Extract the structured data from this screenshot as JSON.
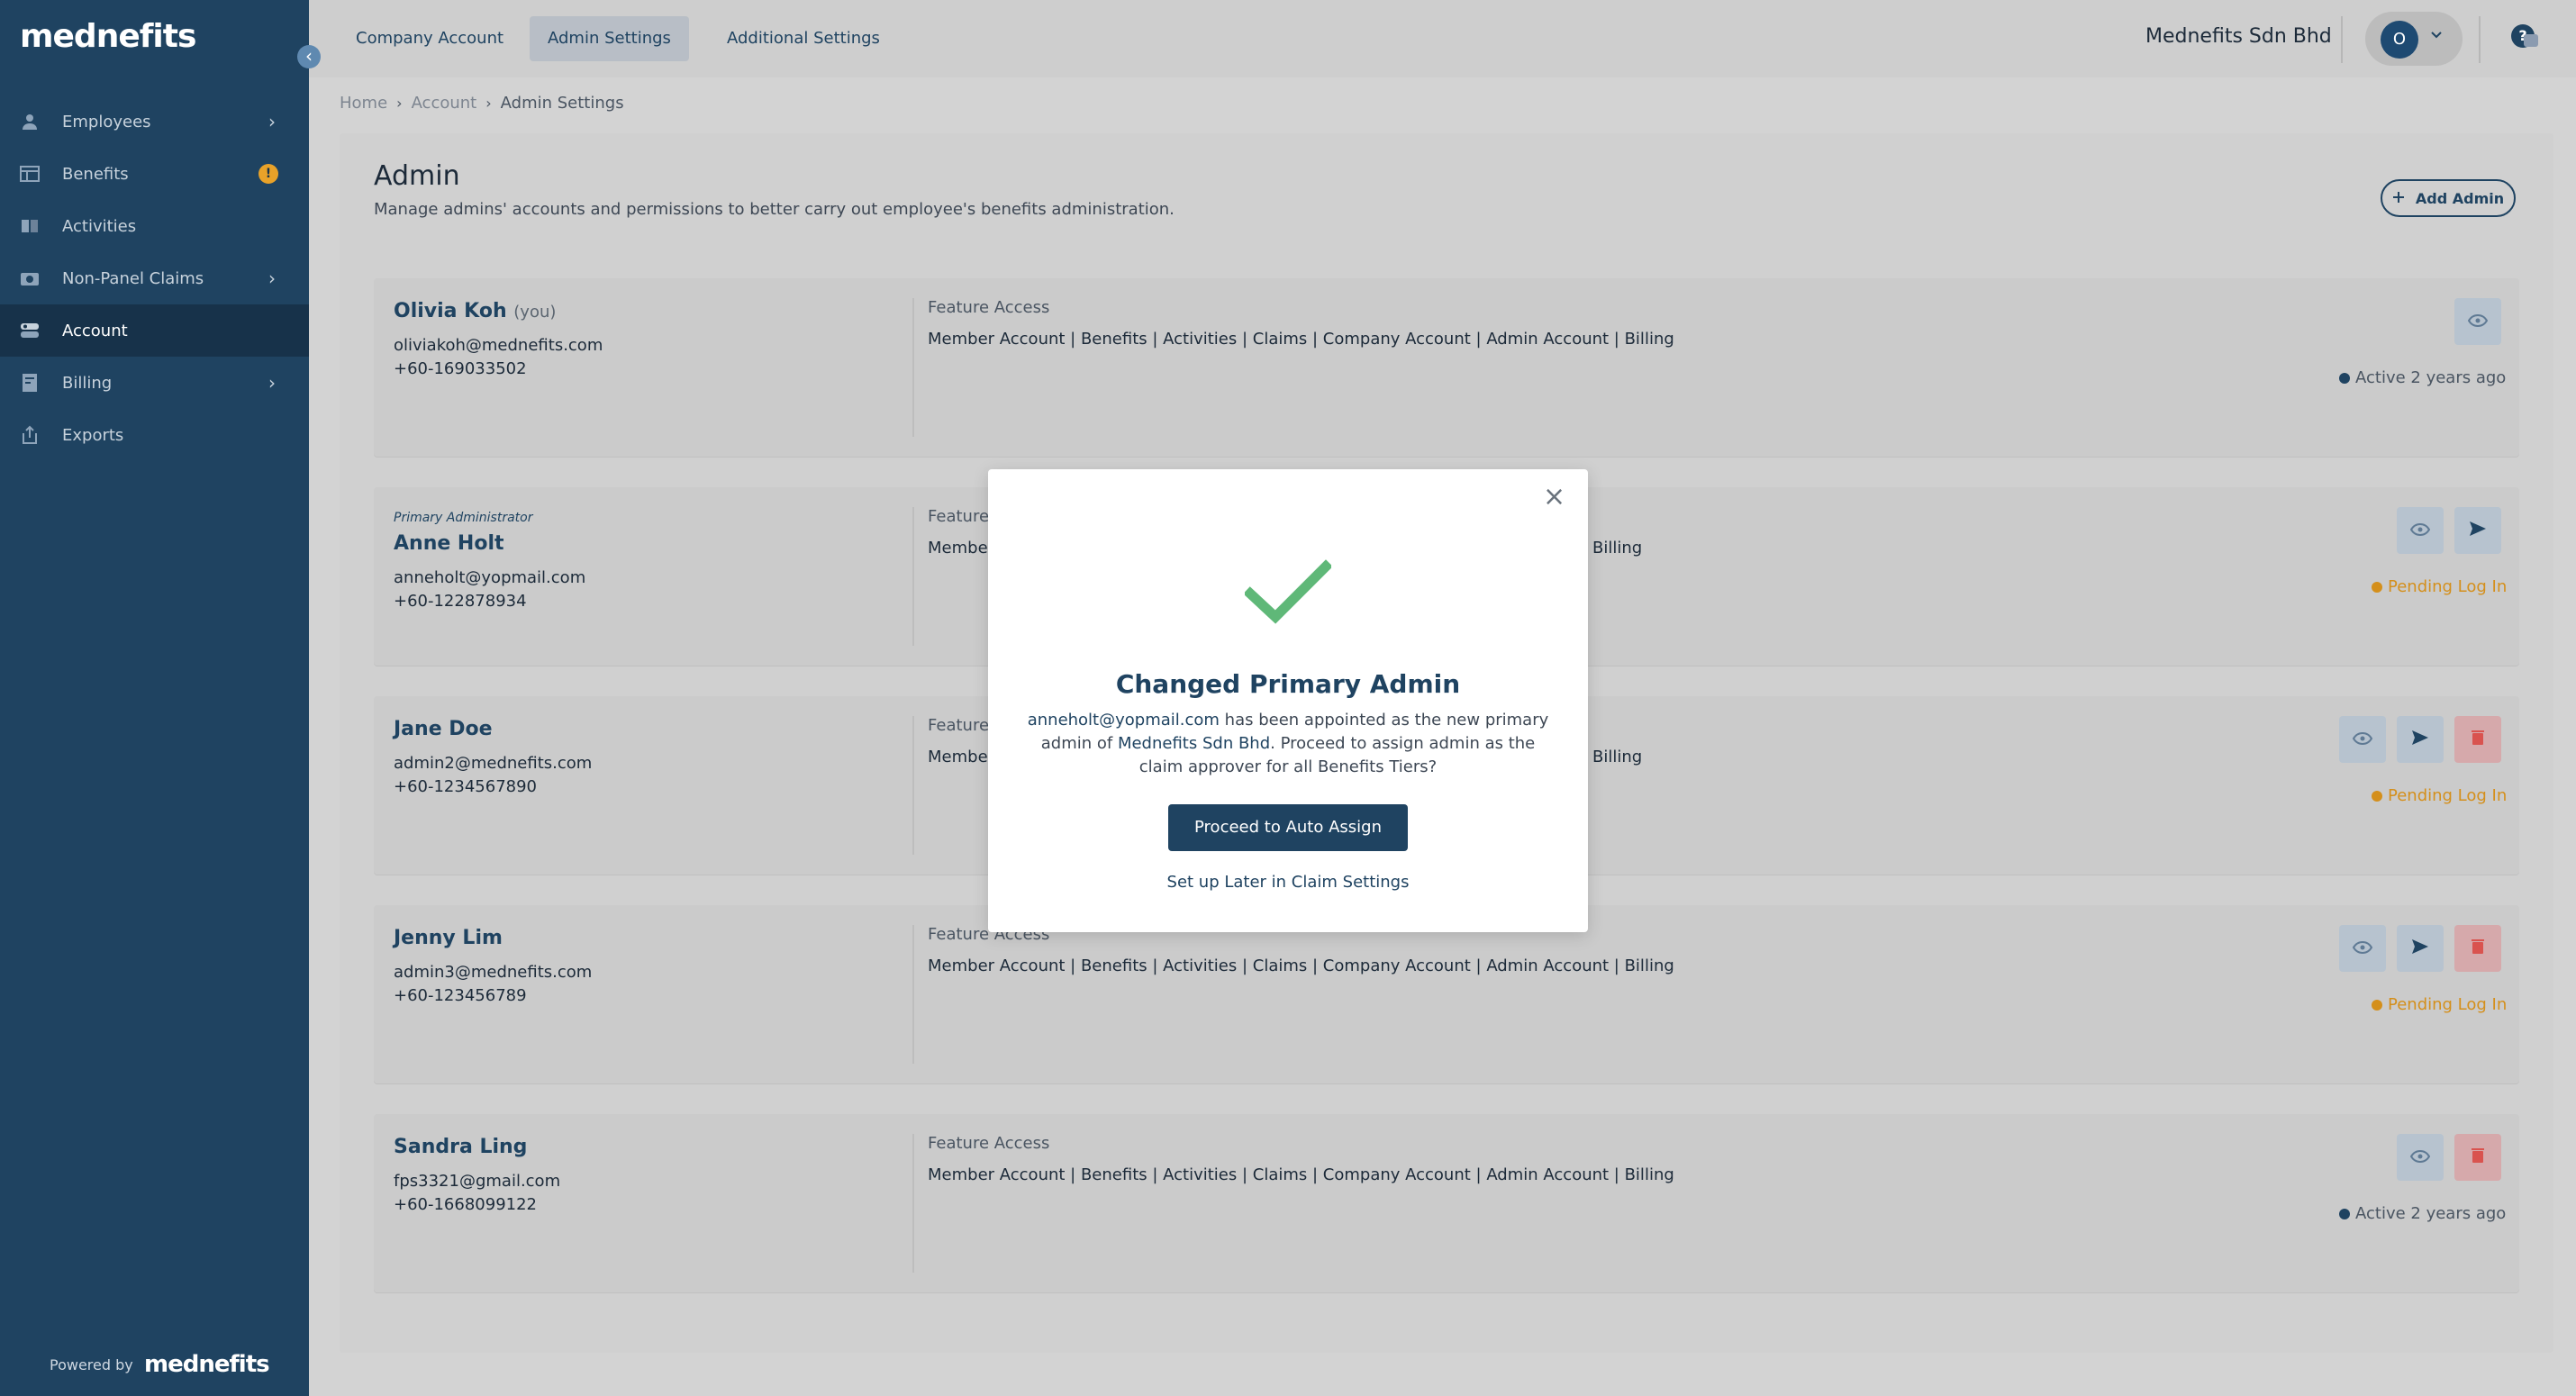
{
  "sidebar": {
    "logo": "mednefits",
    "items": [
      {
        "label": "Employees",
        "icon": "person-icon",
        "chevron": true
      },
      {
        "label": "Benefits",
        "icon": "table-icon",
        "badge": "!"
      },
      {
        "label": "Activities",
        "icon": "book-icon"
      },
      {
        "label": "Non-Panel Claims",
        "icon": "camera-icon",
        "chevron": true
      },
      {
        "label": "Account",
        "icon": "account-icon",
        "active": true
      },
      {
        "label": "Billing",
        "icon": "receipt-icon",
        "chevron": true
      },
      {
        "label": "Exports",
        "icon": "export-icon"
      }
    ],
    "powered_by": "Powered by",
    "powered_logo": "mednefits"
  },
  "topbar": {
    "tabs": [
      {
        "label": "Company Account"
      },
      {
        "label": "Admin Settings",
        "active": true
      },
      {
        "label": "Additional Settings"
      }
    ],
    "company": "Mednefits Sdn Bhd",
    "avatar_initial": "O"
  },
  "breadcrumb": [
    "Home",
    "Account",
    "Admin Settings"
  ],
  "page": {
    "title": "Admin",
    "description": "Manage admins' accounts and permissions to better carry out employee's benefits administration.",
    "add_admin": "Add Admin"
  },
  "feature_access_label": "Feature Access",
  "admins": [
    {
      "name": "Olivia Koh",
      "you": "(you)",
      "email": "oliviakoh@mednefits.com",
      "phone": "+60-169033502",
      "features": "Member Account | Benefits | Activities | Claims | Company Account | Admin Account | Billing",
      "status": "Active 2 years ago"
    },
    {
      "role": "Primary Administrator",
      "name": "Anne Holt",
      "email": "anneholt@yopmail.com",
      "phone": "+60-122878934",
      "features_visible_left": "Membe",
      "features_visible_right": "Billing",
      "status": "Pending Log In"
    },
    {
      "name": "Jane Doe",
      "email": "admin2@mednefits.com",
      "phone": "+60-1234567890",
      "features_visible_left": "Membe",
      "features_visible_right": "Billing",
      "status": "Pending Log In"
    },
    {
      "name": "Jenny Lim",
      "email": "admin3@mednefits.com",
      "phone": "+60-123456789",
      "features": "Member Account | Benefits | Activities | Claims | Company Account | Admin Account | Billing",
      "status": "Pending Log In"
    },
    {
      "name": "Sandra Ling",
      "email": "fps3321@gmail.com",
      "phone": "+60-1668099122",
      "features": "Member Account | Benefits | Activities | Claims | Company Account | Admin Account | Billing",
      "status": "Active 2 years ago"
    }
  ],
  "modal": {
    "title": "Changed Primary Admin",
    "email": "anneholt@yopmail.com",
    "text1": " has been appointed as the new primary admin of ",
    "company": "Mednefits Sdn Bhd",
    "text2": ". Proceed to assign admin as the claim approver for all Benefits Tiers?",
    "proceed": "Proceed to Auto Assign",
    "later": "Set up Later in Claim Settings"
  },
  "colors": {
    "sidebar": "#1f4361",
    "accent": "#1f4361",
    "pending": "#d48f1b",
    "check": "#5fb878",
    "delete": "#d6a9ab"
  }
}
